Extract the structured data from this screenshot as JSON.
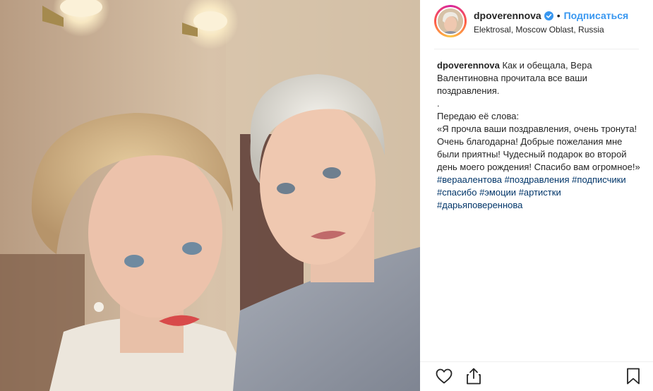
{
  "post": {
    "username": "dpoverennova",
    "follow_label": "Подписаться",
    "separator": "•",
    "location": "Elektrosal, Moscow Oblast, Russia"
  },
  "caption": {
    "username": "dpoverennova",
    "line1": "Как и обещала, Вера Валентиновна прочитала все ваши поздравления.",
    "line2": ".",
    "line3": "Передаю её слова:",
    "line4": "«Я прочла ваши поздравления, очень тронута! Очень благодарна! Добрые пожелания мне были приятны! Чудесный подарок во второй день моего рождения! Спасибо вам огромное!»",
    "hashtags": [
      "#вераалентова",
      "#поздравления",
      "#подписчики",
      "#спасибо",
      "#эмоции",
      "#артистки",
      "#дарьяповереннова"
    ]
  },
  "icons": {
    "verified": "verified-badge-icon",
    "like": "heart-icon",
    "share": "share-icon",
    "save": "bookmark-icon"
  },
  "colors": {
    "accent": "#3897f0",
    "hashtag": "#003569",
    "verified": "#3897f0",
    "text": "#262626"
  }
}
